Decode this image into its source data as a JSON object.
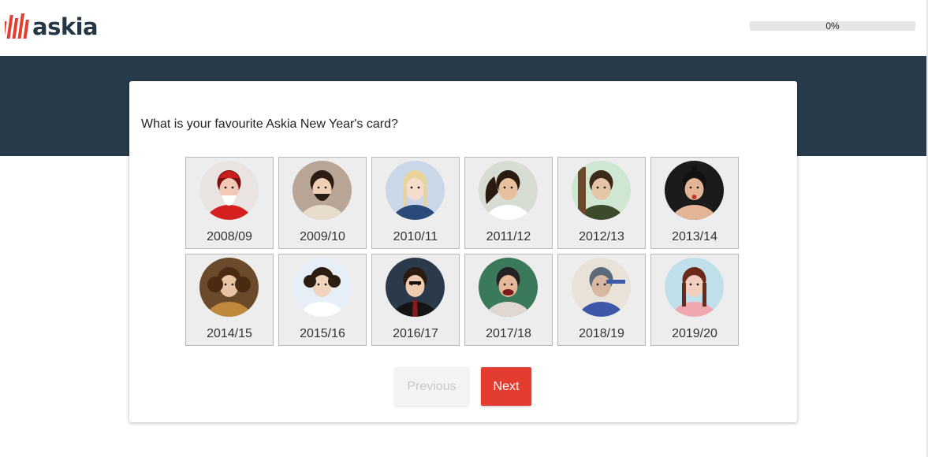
{
  "brand": {
    "name": "askia",
    "logo_color": "#243746",
    "accent_color": "#e23d2e"
  },
  "progress": {
    "value": 0,
    "label": "0%"
  },
  "question": {
    "text": "What is your favourite Askia New Year's card?"
  },
  "options": [
    {
      "label": "2008/09",
      "icon": "santa-portrait"
    },
    {
      "label": "2009/10",
      "icon": "bearded-man-portrait"
    },
    {
      "label": "2010/11",
      "icon": "blonde-braids-portrait"
    },
    {
      "label": "2011/12",
      "icon": "windswept-hair-portrait"
    },
    {
      "label": "2012/13",
      "icon": "tower-climber-portrait"
    },
    {
      "label": "2013/14",
      "icon": "sumo-portrait"
    },
    {
      "label": "2014/15",
      "icon": "curly-wig-portrait"
    },
    {
      "label": "2015/16",
      "icon": "white-robe-portrait"
    },
    {
      "label": "2016/17",
      "icon": "suit-glasses-portrait"
    },
    {
      "label": "2017/18",
      "icon": "laughing-man-portrait"
    },
    {
      "label": "2018/19",
      "icon": "statue-pose-portrait"
    },
    {
      "label": "2019/20",
      "icon": "pigtails-portrait"
    }
  ],
  "navigation": {
    "previous_label": "Previous",
    "next_label": "Next"
  }
}
